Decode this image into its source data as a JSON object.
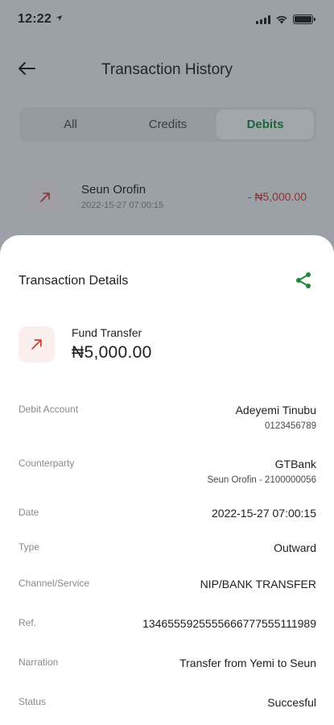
{
  "status_bar": {
    "time": "12:22"
  },
  "header": {
    "title": "Transaction History"
  },
  "tabs": [
    {
      "label": "All"
    },
    {
      "label": "Credits"
    },
    {
      "label": "Debits"
    }
  ],
  "background_row": {
    "name": "Seun Orofin",
    "timestamp": "2022-15-27  07:00:15",
    "amount": "- ₦5,000.00"
  },
  "sheet": {
    "title": "Transaction Details",
    "transaction_type": "Fund Transfer",
    "amount": "₦5,000.00",
    "details": {
      "debit_account": {
        "label": "Debit Account",
        "name": "Adeyemi Tinubu",
        "number": "0123456789"
      },
      "counterparty": {
        "label": "Counterparty",
        "bank": "GTBank",
        "account": "Seun Orofin - 2100000056"
      },
      "date": {
        "label": "Date",
        "value": "2022-15-27  07:00:15"
      },
      "type": {
        "label": "Type",
        "value": "Outward"
      },
      "channel": {
        "label": "Channel/Service",
        "value": "NIP/BANK TRANSFER"
      },
      "ref": {
        "label": "Ref.",
        "value": "134655592555566677755511198​9"
      },
      "narration": {
        "label": "Narration",
        "value": "Transfer from Yemi to Seun"
      },
      "status": {
        "label": "Status",
        "value": "Succesful"
      }
    }
  },
  "colors": {
    "accent_green": "#1f8a3a",
    "debit_red": "#d23b2f",
    "debit_icon_bg": "#fbefee"
  }
}
